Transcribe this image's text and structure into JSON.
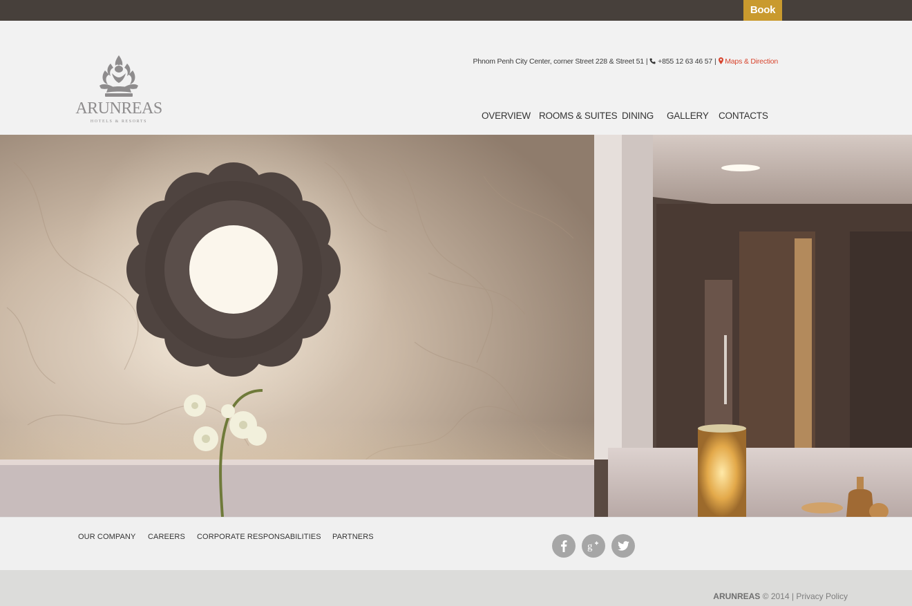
{
  "topbar": {
    "book_label": "Book",
    "accent_color": "#c99a2e",
    "bg_color": "#47403b"
  },
  "brand": {
    "name": "ARUNREAS",
    "tagline": "HOTELS & RESORTS"
  },
  "contact": {
    "address": "Phnom Penh City Center, corner Street 228 & Street 51",
    "phone": "+855 12 63 46 57",
    "map_label": "Maps & Direction",
    "separator": "|",
    "icons": [
      "phone-icon",
      "map-marker-icon"
    ],
    "link_color": "#d8452e"
  },
  "nav": {
    "items": [
      {
        "label": "OVERVIEW"
      },
      {
        "label": "ROOMS & SUITES"
      },
      {
        "label": "DINING"
      },
      {
        "label": "GALLERY"
      },
      {
        "label": "CONTACTS"
      }
    ]
  },
  "hero": {
    "image": "hotel-lobby-photo"
  },
  "footer": {
    "links": [
      {
        "label": "OUR COMPANY"
      },
      {
        "label": "CAREERS"
      },
      {
        "label": "CORPORATE RESPONSABILITIES"
      },
      {
        "label": "PARTNERS"
      }
    ],
    "social": [
      {
        "icon": "facebook-icon"
      },
      {
        "icon": "google-plus-icon"
      },
      {
        "icon": "twitter-icon"
      }
    ],
    "copyright_brand": "ARUNREAS",
    "copyright_text": "© 2014 |",
    "privacy_label": "Privacy Policy"
  }
}
